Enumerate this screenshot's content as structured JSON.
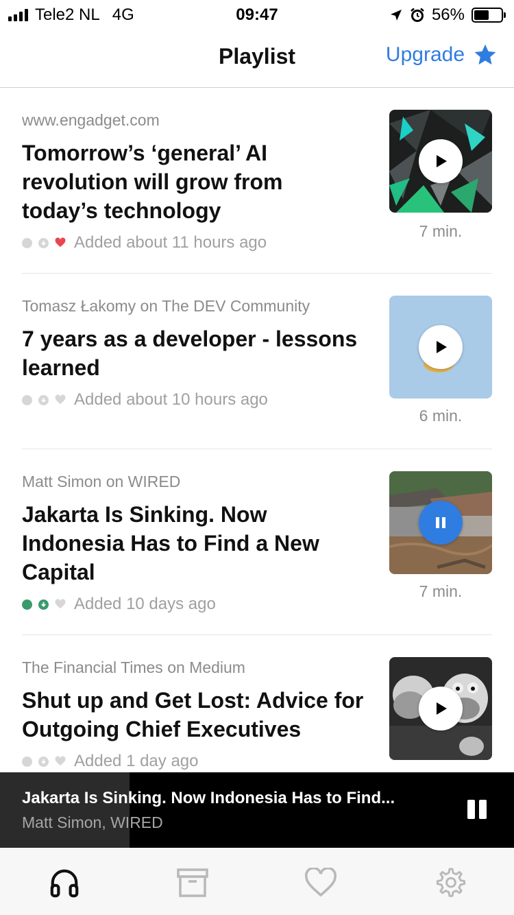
{
  "status_bar": {
    "carrier": "Tele2 NL",
    "network": "4G",
    "time": "09:47",
    "battery": "56%"
  },
  "header": {
    "title": "Playlist",
    "upgrade_label": "Upgrade"
  },
  "articles": [
    {
      "source": "www.engadget.com",
      "title": "Tomorrow’s ‘general’ AI revolution will grow from today’s technology",
      "added": "Added about 11 hours ago",
      "duration": "7 min.",
      "favorited": true,
      "downloaded": false,
      "state": "play"
    },
    {
      "source": "Tomasz Łakomy on The DEV Community",
      "title": "7 years as a developer - lessons learned",
      "added": "Added about 10 hours ago",
      "duration": "6 min.",
      "favorited": false,
      "downloaded": false,
      "state": "play"
    },
    {
      "source": "Matt Simon on WIRED",
      "title": "Jakarta Is Sinking. Now Indonesia Has to Find a New Capital",
      "added": "Added 10 days ago",
      "duration": "7 min.",
      "favorited": false,
      "downloaded": true,
      "state": "pause"
    },
    {
      "source": "The Financial Times on Medium",
      "title": "Shut up and Get Lost: Advice for Outgoing Chief Executives",
      "added": "Added 1 day ago",
      "duration": "",
      "favorited": false,
      "downloaded": false,
      "state": "play"
    }
  ],
  "now_playing": {
    "title": "Jakarta Is Sinking. Now Indonesia Has to Find...",
    "subtitle": "Matt Simon, WIRED",
    "progress": 0.25
  },
  "tabs": [
    "headphones-icon",
    "archive-icon",
    "heart-icon",
    "gear-icon"
  ],
  "colors": {
    "accent": "#2f7de1",
    "favorite": "#e8474f",
    "downloaded": "#3a9a6b"
  }
}
